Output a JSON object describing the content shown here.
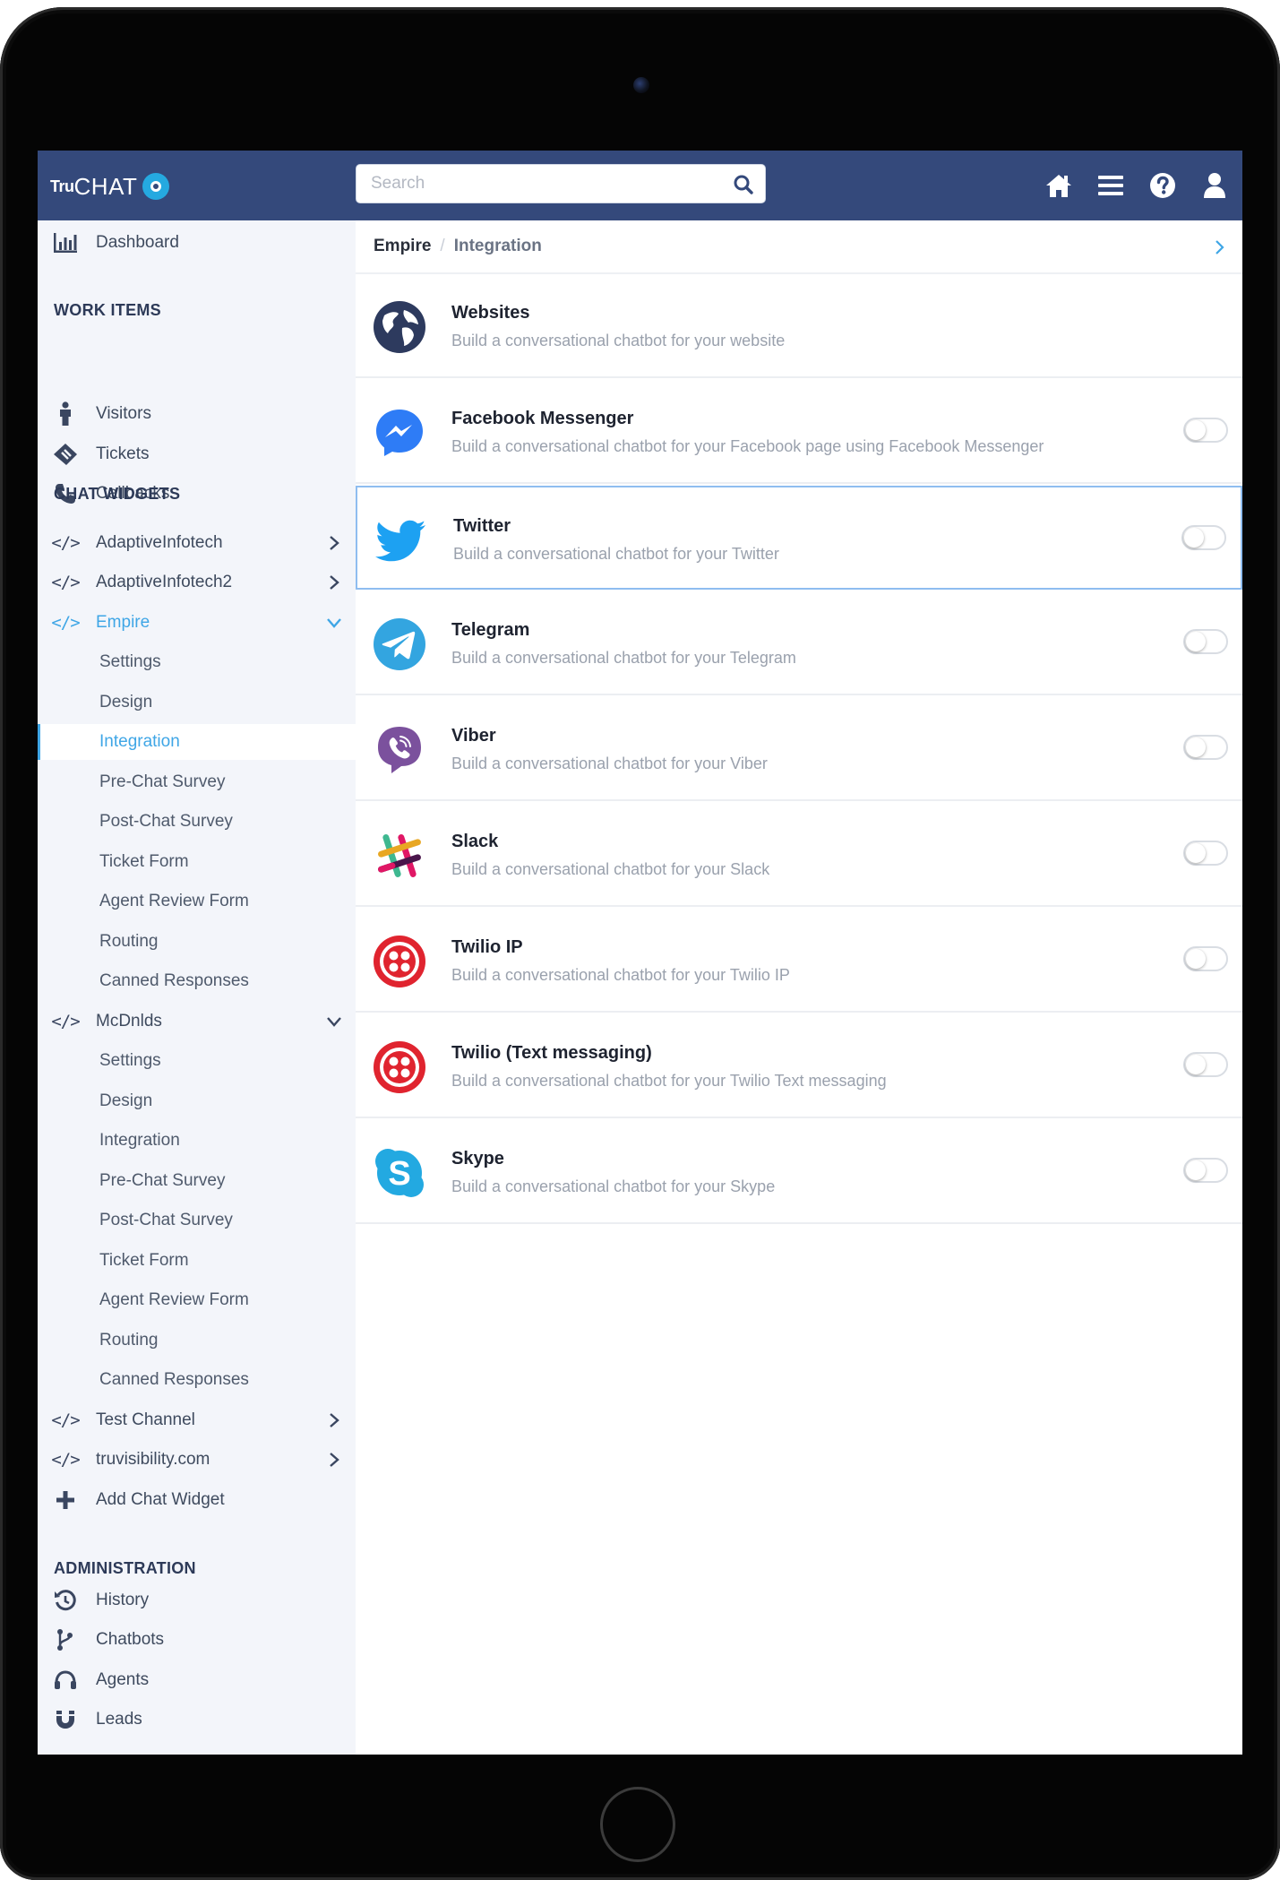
{
  "app": {
    "logo_prefix": "Tru",
    "logo_main": "CHAT"
  },
  "search": {
    "placeholder": "Search",
    "value": ""
  },
  "sidebar": {
    "dashboard": "Dashboard",
    "work_items_heading": "WORK ITEMS",
    "work_items": [
      "Visitors",
      "Tickets",
      "Callbacks"
    ],
    "chat_widgets_heading": "CHAT WIDGETS",
    "widgets": [
      {
        "label": "AdaptiveInfotech",
        "expanded": false
      },
      {
        "label": "AdaptiveInfotech2",
        "expanded": false
      },
      {
        "label": "Empire",
        "expanded": true,
        "active": true,
        "children": [
          "Settings",
          "Design",
          "Integration",
          "Pre-Chat Survey",
          "Post-Chat Survey",
          "Ticket Form",
          "Agent Review Form",
          "Routing",
          "Canned Responses"
        ]
      },
      {
        "label": "McDnlds",
        "expanded": true,
        "children": [
          "Settings",
          "Design",
          "Integration",
          "Pre-Chat Survey",
          "Post-Chat Survey",
          "Ticket Form",
          "Agent Review Form",
          "Routing",
          "Canned Responses"
        ]
      },
      {
        "label": "Test Channel",
        "expanded": false
      },
      {
        "label": "truvisibility.com",
        "expanded": false
      }
    ],
    "add_widget": "Add Chat Widget",
    "admin_heading": "ADMINISTRATION",
    "admin_items": [
      "History",
      "Chatbots",
      "Agents",
      "Leads"
    ],
    "active_child": "Integration"
  },
  "breadcrumb": {
    "parent": "Empire",
    "separator": "/",
    "current": "Integration"
  },
  "integrations": [
    {
      "title": "Websites",
      "desc": "Build a conversational chatbot for your website",
      "icon": "globe-icon",
      "toggle": false,
      "has_toggle": false
    },
    {
      "title": "Facebook Messenger",
      "desc": "Build a conversational chatbot for your Facebook page using Facebook Messenger",
      "icon": "messenger-icon",
      "toggle": false,
      "has_toggle": true
    },
    {
      "title": "Twitter",
      "desc": "Build a conversational chatbot for your Twitter",
      "icon": "twitter-icon",
      "toggle": false,
      "has_toggle": true,
      "selected": true
    },
    {
      "title": "Telegram",
      "desc": "Build a conversational chatbot for your Telegram",
      "icon": "telegram-icon",
      "toggle": false,
      "has_toggle": true
    },
    {
      "title": "Viber",
      "desc": "Build a conversational chatbot for your Viber",
      "icon": "viber-icon",
      "toggle": false,
      "has_toggle": true
    },
    {
      "title": "Slack",
      "desc": "Build a conversational chatbot for your Slack",
      "icon": "slack-icon",
      "toggle": false,
      "has_toggle": true
    },
    {
      "title": "Twilio IP",
      "desc": "Build a conversational chatbot for your Twilio IP",
      "icon": "twilio-icon",
      "toggle": false,
      "has_toggle": true
    },
    {
      "title": "Twilio (Text messaging)",
      "desc": "Build a conversational chatbot for your Twilio Text messaging",
      "icon": "twilio-icon",
      "toggle": false,
      "has_toggle": true
    },
    {
      "title": "Skype",
      "desc": "Build a conversational chatbot for your Skype",
      "icon": "skype-icon",
      "toggle": false,
      "has_toggle": true
    }
  ],
  "colors": {
    "topbar": "#34497b",
    "accent": "#3fa6e6",
    "sidebar_bg": "#f3f5fa"
  }
}
